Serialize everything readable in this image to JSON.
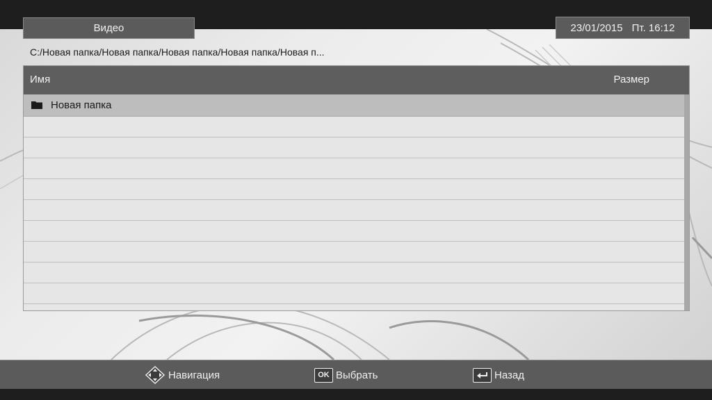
{
  "window": {
    "title": "Видео"
  },
  "header": {
    "date": "23/01/2015",
    "day": "Пт.",
    "time": "16:12"
  },
  "breadcrumb": {
    "path": "C:/Новая папка/Новая папка/Новая папка/Новая папка/Новая п..."
  },
  "file_list": {
    "columns": {
      "name": "Имя",
      "size": "Размер"
    },
    "items": [
      {
        "name": "Новая папка",
        "icon": "folder-icon",
        "selected": true
      }
    ]
  },
  "footer": {
    "navigation_label": "Навигация",
    "ok_key": "OK",
    "select_label": "Выбрать",
    "back_label": "Назад"
  },
  "colors": {
    "panel": "#5b5b5b",
    "selected_row": "#bdbdbd",
    "list_bg": "#e6e6e6"
  }
}
